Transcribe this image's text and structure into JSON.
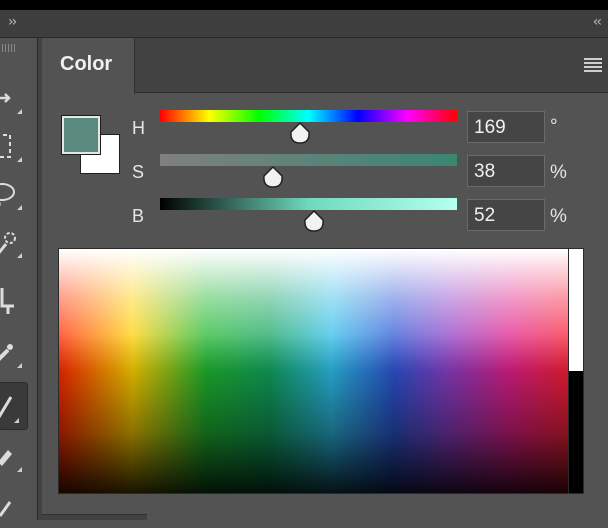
{
  "header": {
    "expand_left": "››",
    "expand_right": "‹‹"
  },
  "toolbar": {
    "tools": [
      {
        "name": "move-tool",
        "icon": "move-arrow-icon"
      },
      {
        "name": "marquee-tool",
        "icon": "rect-marquee-icon"
      },
      {
        "name": "lasso-tool",
        "icon": "lasso-icon"
      },
      {
        "name": "quick-select-tool",
        "icon": "quick-select-icon"
      },
      {
        "name": "crop-tool",
        "icon": "crop-icon"
      },
      {
        "name": "eyedropper-tool",
        "icon": "eyedropper-icon"
      },
      {
        "name": "brush-tool",
        "icon": "brush-icon"
      },
      {
        "name": "eraser-tool",
        "icon": "eraser-icon"
      },
      {
        "name": "pen-tool",
        "icon": "pen-icon"
      }
    ]
  },
  "panel": {
    "title": "Color",
    "menu_icon": "hamburger-icon"
  },
  "color": {
    "foreground": "#5a8a7d",
    "background": "#ffffff",
    "sliders": [
      {
        "label": "H",
        "value": "169",
        "unit": "°",
        "fraction": 0.47
      },
      {
        "label": "S",
        "value": "38",
        "unit": "%",
        "fraction": 0.38
      },
      {
        "label": "B",
        "value": "52",
        "unit": "%",
        "fraction": 0.52
      }
    ]
  }
}
